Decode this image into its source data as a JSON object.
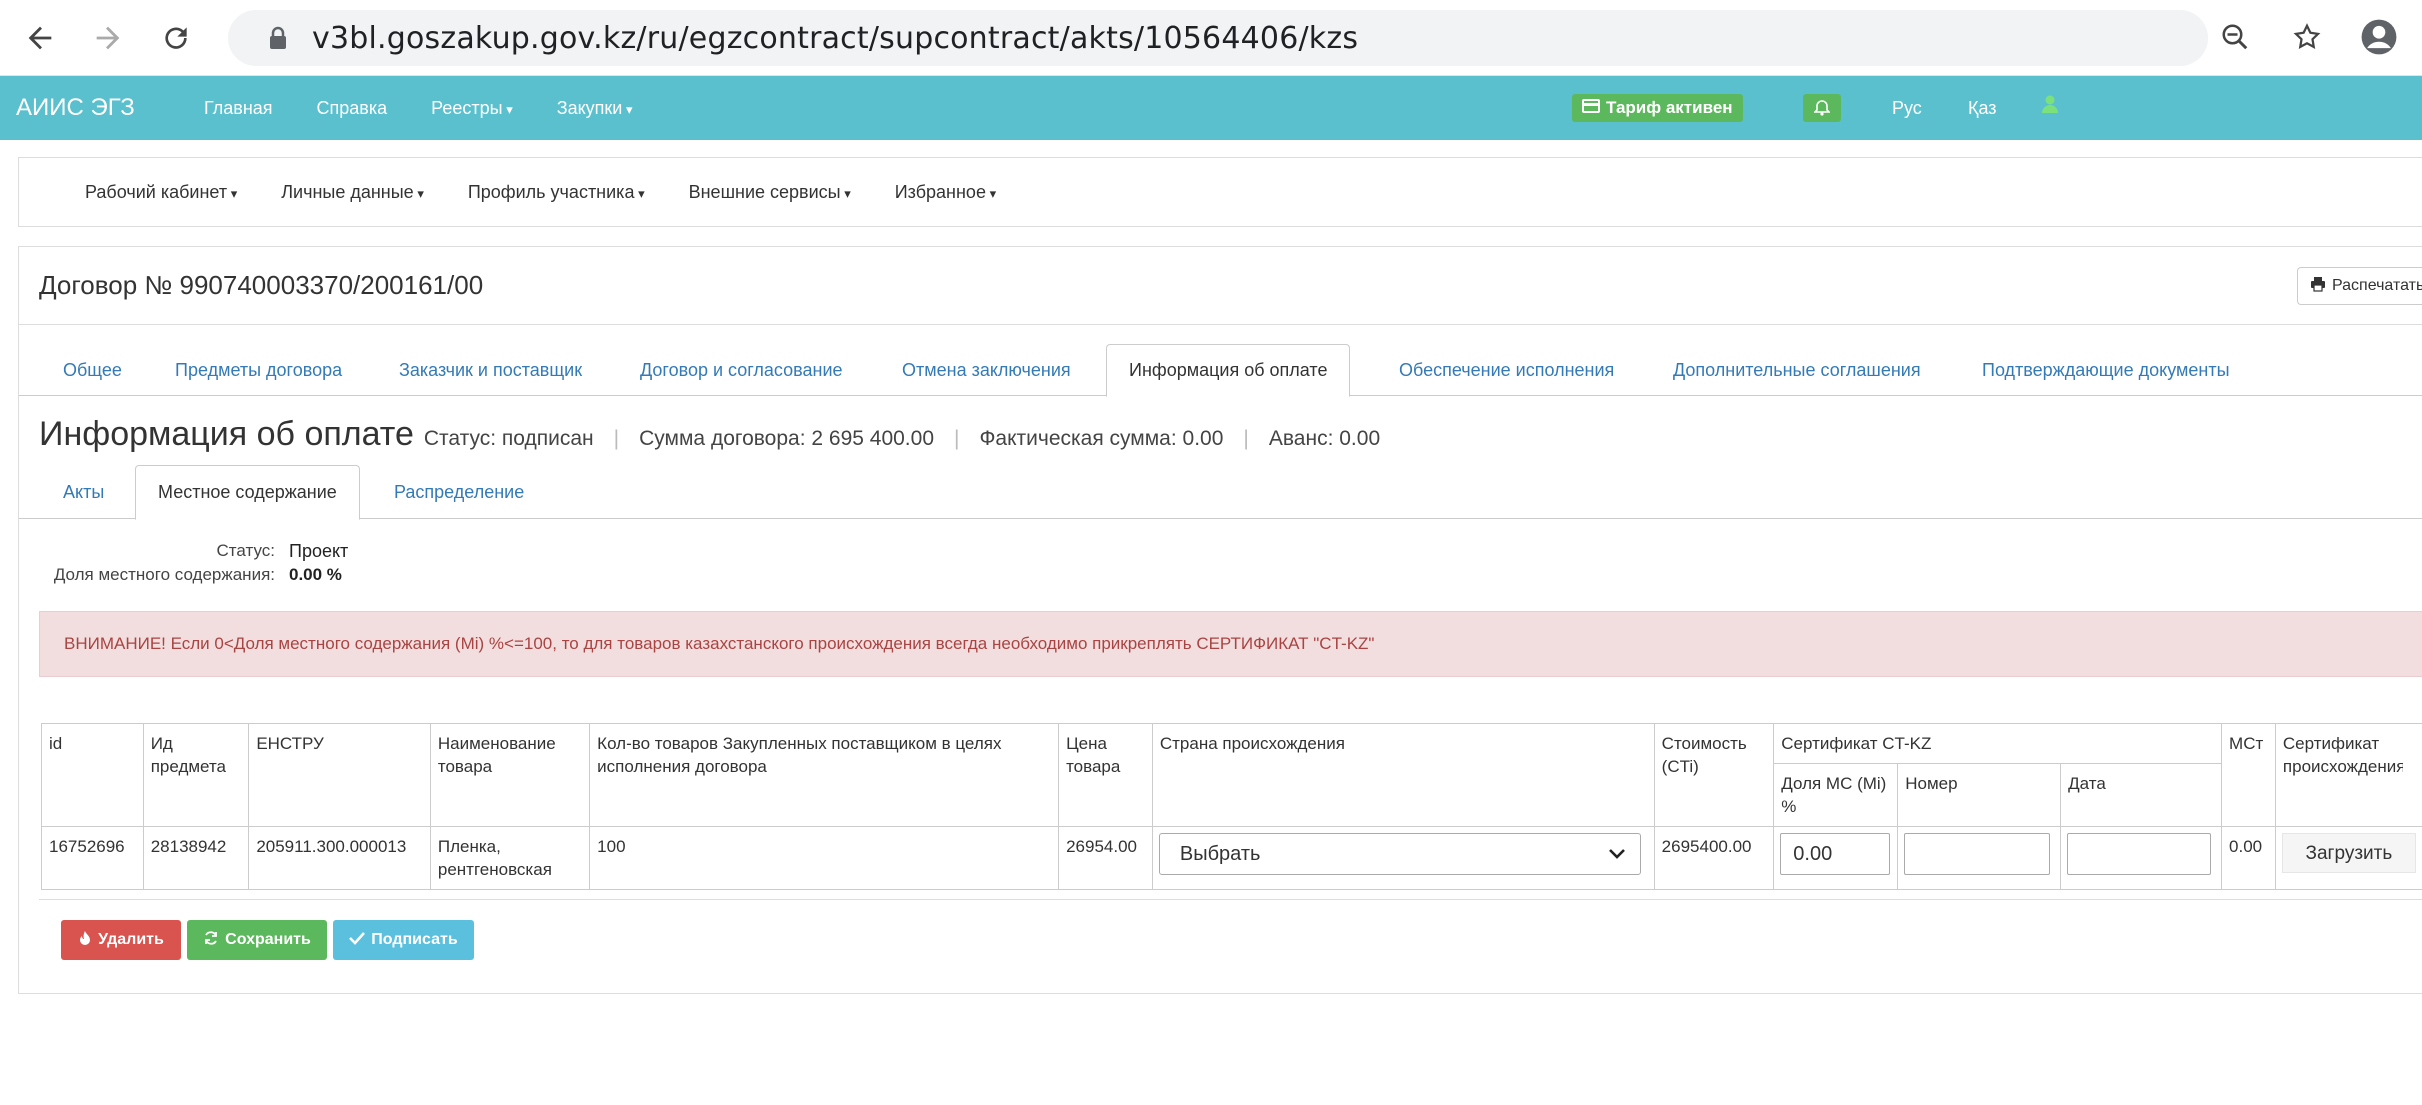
{
  "browser": {
    "url": "v3bl.goszakup.gov.kz/ru/egzcontract/supcontract/akts/10564406/kzs"
  },
  "appbar": {
    "brand": "АИИС ЭГЗ",
    "menu": [
      "Главная",
      "Справка",
      "Реестры",
      "Закупки"
    ],
    "tariff": "Тариф активен",
    "lang_ru": "Рус",
    "lang_kz": "Қаз"
  },
  "submenu": [
    "Рабочий кабинет",
    "Личные данные",
    "Профиль участника",
    "Внешние сервисы",
    "Избранное"
  ],
  "contract": {
    "title": "Договор № 990740003370/200161/00",
    "print_label": "Распечатать"
  },
  "tabs": [
    "Общее",
    "Предметы договора",
    "Заказчик и поставщик",
    "Договор и согласование",
    "Отмена заключения",
    "Информация об оплате",
    "Обеспечение исполнения",
    "Дополнительные соглашения",
    "Подтверждающие документы"
  ],
  "info": {
    "heading": "Информация об оплате",
    "status": "Статус: подписан",
    "sum": "Сумма договора: 2 695 400.00",
    "actual": "Фактическая сумма: 0.00",
    "advance": "Аванс: 0.00"
  },
  "subtabs": [
    "Акты",
    "Местное содержание",
    "Распределение"
  ],
  "local_content": {
    "status_label": "Статус:",
    "status_value": "Проект",
    "share_label": "Доля местного содержания:",
    "share_value": "0.00 %"
  },
  "alert": "ВНИМАНИЕ! Если 0<Доля местного содержания (Mi) %<=100, то для товаров казахстанского происхождения всегда необходимо прикреплять СЕРТИФИКАТ \"CT-KZ\"",
  "table": {
    "headers": {
      "id": "id",
      "item_id": "Ид предмета",
      "enstru": "ЕНСТРУ",
      "name": "Наименование товара",
      "qty": "Кол-во товаров Закупленных поставщиком в целях исполнения договора",
      "price": "Цена товара",
      "country": "Страна происхождения",
      "cost": "Стоимость (CTi)",
      "cert": "Сертификат CT-KZ",
      "cert_share": "Доля МС (Mi) %",
      "cert_number": "Номер",
      "cert_date": "Дата",
      "mst": "МСт",
      "cert_origin": "Сертификат происхождения"
    },
    "row": {
      "id": "16752696",
      "item_id": "28138942",
      "enstru": "205911.300.000013",
      "name": "Пленка, рентгеновская",
      "qty": "100",
      "price": "26954.00",
      "country_select": "Выбрать",
      "cost": "2695400.00",
      "cert_share": "0.00",
      "cert_number": "",
      "cert_date": "",
      "mst": "0.00",
      "upload": "Загрузить"
    }
  },
  "actions": {
    "delete": "Удалить",
    "save": "Сохранить",
    "sign": "Подписать"
  }
}
